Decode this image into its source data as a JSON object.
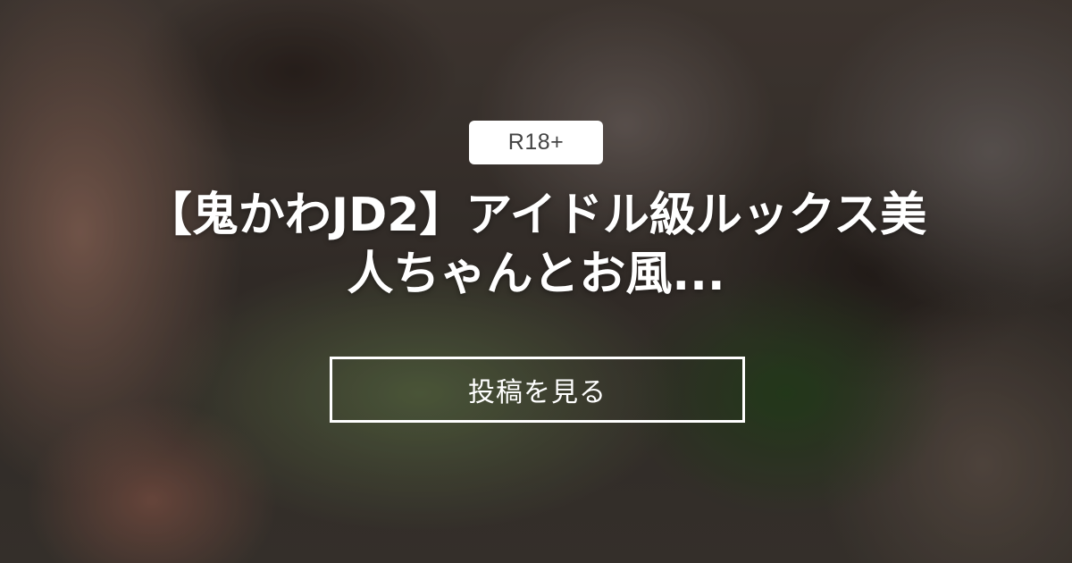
{
  "badge": {
    "label": "R18+"
  },
  "post": {
    "title": "【鬼かわJD2】アイドル級ルックス美人ちゃんとお風..."
  },
  "cta": {
    "label": "投稿を見る"
  },
  "colors": {
    "text": "#ffffff",
    "badge_background": "#ffffff",
    "badge_text": "#444444"
  }
}
